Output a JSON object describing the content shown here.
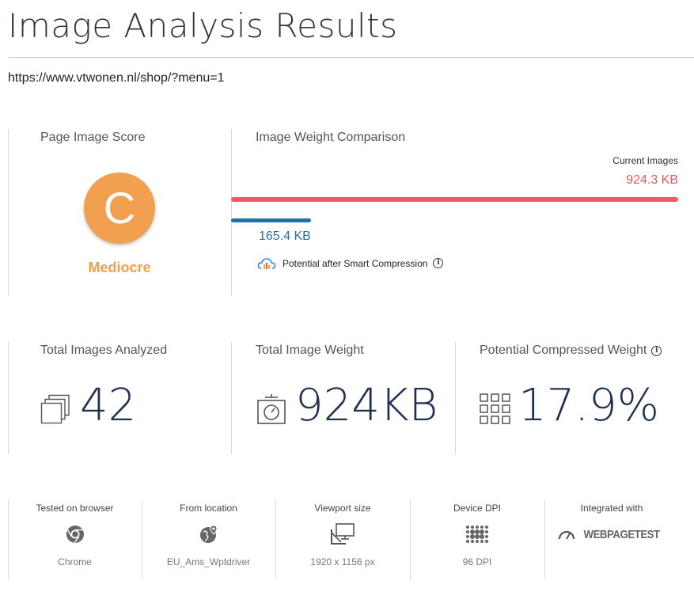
{
  "header": {
    "title": "Image Analysis Results",
    "url": "https://www.vtwonen.nl/shop/?menu=1"
  },
  "score": {
    "label": "Page Image Score",
    "grade": "C",
    "rating": "Mediocre",
    "color": "#f0a04e"
  },
  "comparison": {
    "label": "Image Weight Comparison",
    "current_label": "Current Images",
    "current_value": "924.3 KB",
    "potential_value": "165.4 KB",
    "potential_label": "Potential after Smart Compression",
    "potential_fraction": 0.179
  },
  "stats": {
    "total_images_label": "Total Images Analyzed",
    "total_images_value": "42",
    "total_weight_label": "Total Image Weight",
    "total_weight_value": "924KB",
    "compressed_label": "Potential Compressed Weight",
    "compressed_value": "17.9%"
  },
  "env": {
    "browser_label": "Tested on browser",
    "browser_value": "Chrome",
    "location_label": "From location",
    "location_value": "EU_Ams_Wptdriver",
    "viewport_label": "Viewport size",
    "viewport_value": "1920 x 1156 px",
    "dpi_label": "Device DPI",
    "dpi_value": "96 DPI",
    "integrated_label": "Integrated with",
    "integrated_value": "WEBPAGETEST"
  },
  "icons": {
    "info": "i",
    "cloud": "cloud-icon",
    "images": "stacked-images-icon",
    "scale": "scale-icon",
    "grid": "grid-icon",
    "browser": "chrome-icon",
    "location": "location-pin-icon",
    "viewport": "monitor-icon",
    "dpi": "dots-icon",
    "speedometer": "speedometer-icon"
  }
}
